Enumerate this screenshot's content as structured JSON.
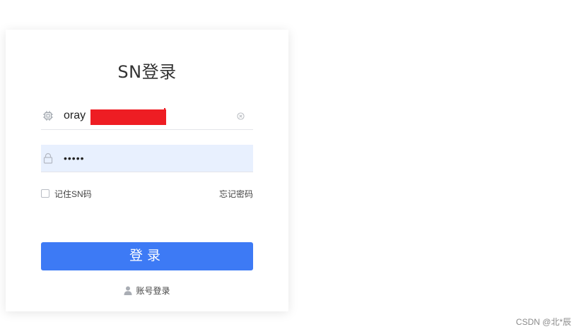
{
  "login_card": {
    "title": "SN登录",
    "sn_field": {
      "value": "oray",
      "icon": "chip-icon",
      "clear_icon": "clear-icon"
    },
    "password_field": {
      "value": "•••••",
      "icon": "lock-icon",
      "background_color": "#e8f0fe"
    },
    "remember_label": "记住SN码",
    "forgot_label": "忘记密码",
    "login_button_label": "登录",
    "login_button_color": "#3d7af5",
    "account_login_label": "账号登录",
    "redaction_color": "#ee1d23"
  },
  "watermark": "CSDN @北*辰"
}
